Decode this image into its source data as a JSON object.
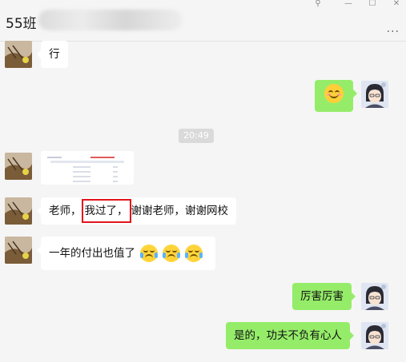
{
  "header": {
    "title": "55班",
    "more_label": "..."
  },
  "window_controls": {
    "pin": "⚲",
    "minimize": "—",
    "maximize": "☐",
    "close": "✕"
  },
  "timestamp": "20:49",
  "messages": {
    "m1": "行",
    "m4_part1": "老师，",
    "m4_highlight": "我过了，",
    "m4_part2": "谢谢老师，谢谢网校",
    "m5_text": "一年的付出也值了",
    "m6": "厉害厉害",
    "m7": "是的，功夫不负有心人"
  },
  "colors": {
    "green_bubble": "#95ec69",
    "highlight_border": "#e0151b"
  }
}
